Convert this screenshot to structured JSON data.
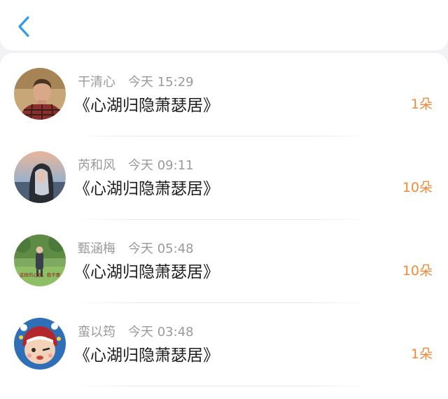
{
  "header": {
    "back_icon": "chevron-left-icon",
    "accent_color": "#2e9bf0"
  },
  "list": {
    "items": [
      {
        "name": "干清心",
        "time": "今天 15:29",
        "title": "《心湖归隐萧瑟居》",
        "count": "1朵",
        "avatar": "young-man-plaid-shirt"
      },
      {
        "name": "芮和风",
        "time": "今天 09:11",
        "title": "《心湖归隐萧瑟居》",
        "count": "10朵",
        "avatar": "girl-silver-hair-seaside"
      },
      {
        "name": "甄涵梅",
        "time": "今天 05:48",
        "title": "《心湖归隐萧瑟居》",
        "count": "10朵",
        "avatar": "girl-standing-in-garden",
        "avatar_caption": "这样的心跳，我不要"
      },
      {
        "name": "蛮以筠",
        "time": "今天 03:48",
        "title": "《心湖归隐萧瑟居》",
        "count": "1朵",
        "avatar": "cartoon-winking-kid"
      }
    ],
    "count_color": "#f08a3a"
  }
}
